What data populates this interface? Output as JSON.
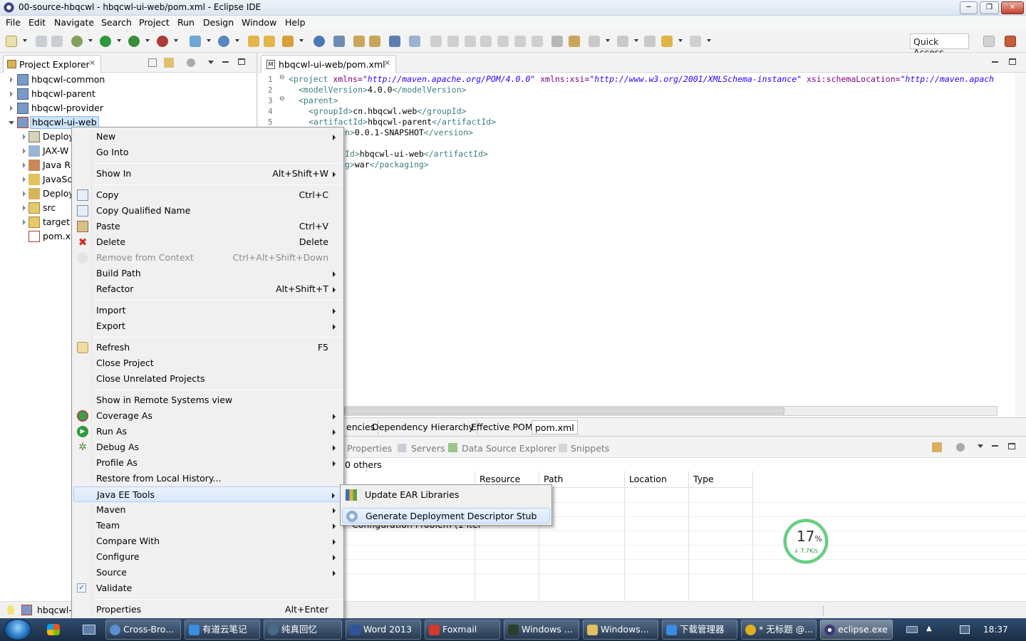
{
  "window": {
    "title": "00-source-hbqcwl - hbqcwl-ui-web/pom.xml - Eclipse IDE",
    "minimize": "─",
    "maximize": "❐",
    "close": "✕"
  },
  "menubar": [
    "File",
    "Edit",
    "Navigate",
    "Search",
    "Project",
    "Run",
    "Design",
    "Window",
    "Help"
  ],
  "toolbar": {
    "quick_access": "Quick Access"
  },
  "explorer": {
    "tab_label": "Project Explorer",
    "items": [
      "hbqcwl-common",
      "hbqcwl-parent",
      "hbqcwl-provider",
      "hbqcwl-ui-web"
    ],
    "children": [
      "Deploy",
      "JAX-W",
      "Java R",
      "JavaSc",
      "Deploy",
      "src",
      "target",
      "pom.xr"
    ]
  },
  "editor": {
    "tab_label": "hbqcwl-ui-web/pom.xml",
    "line_numbers": [
      "1",
      "2",
      "3",
      "4",
      "5"
    ],
    "lines": [
      {
        "tag1": "<project",
        "att1": " xmlns=",
        "val1": "\"http://maven.apache.org/POM/4.0.0\"",
        "att2": " xmlns:xsi=",
        "val2": "\"http://www.w3.org/2001/XMLSchema-instance\"",
        "att3": " xsi:schemaLocation=",
        "val3": "\"http://maven.apach"
      },
      {
        "open": "<modelVersion>",
        "text": "4.0.0",
        "close": "</modelVersion>"
      },
      {
        "open": "<parent>"
      },
      {
        "open": "<groupId>",
        "text": "cn.hbqcwl.web",
        "close": "</groupId>"
      },
      {
        "open": "<artifactId>",
        "text": "hbqcwl-parent",
        "close": "</artifactId>"
      },
      {
        "open": "n>",
        "text": "0.0.1-SNAPSHOT",
        "close": "</version>"
      },
      {
        "open": "Id>",
        "text": "hbqcwl-ui-web",
        "close": "</artifactId>"
      },
      {
        "open": "g>",
        "text": "war",
        "close": "</packaging>"
      }
    ]
  },
  "pom_tabs": [
    "encies",
    "Dependency Hierarchy",
    "Effective POM",
    "pom.xml"
  ],
  "bottom": {
    "tabs": [
      "Properties",
      "Servers",
      "Data Source Explorer",
      "Snippets"
    ],
    "summary": "0 others",
    "columns": [
      "Resource",
      "Path",
      "Location",
      "Type"
    ],
    "row_text": "Configuration Problem (1 iter"
  },
  "context_menu": [
    {
      "label": "New",
      "submenu": true
    },
    {
      "label": "Go Into"
    },
    {
      "sep": true
    },
    {
      "label": "Show In",
      "shortcut": "Alt+Shift+W",
      "submenu": true
    },
    {
      "sep": true
    },
    {
      "label": "Copy",
      "shortcut": "Ctrl+C",
      "icon": "copy-icon"
    },
    {
      "label": "Copy Qualified Name",
      "icon": "copy-qualified-icon"
    },
    {
      "label": "Paste",
      "shortcut": "Ctrl+V",
      "icon": "paste-icon"
    },
    {
      "label": "Delete",
      "shortcut": "Delete",
      "icon": "delete-icon"
    },
    {
      "label": "Remove from Context",
      "shortcut": "Ctrl+Alt+Shift+Down",
      "disabled": true,
      "icon": "remove-context-icon"
    },
    {
      "label": "Build Path",
      "submenu": true
    },
    {
      "label": "Refactor",
      "shortcut": "Alt+Shift+T",
      "submenu": true
    },
    {
      "sep": true
    },
    {
      "label": "Import",
      "submenu": true
    },
    {
      "label": "Export",
      "submenu": true
    },
    {
      "sep": true
    },
    {
      "label": "Refresh",
      "shortcut": "F5",
      "icon": "refresh-icon"
    },
    {
      "label": "Close Project"
    },
    {
      "label": "Close Unrelated Projects"
    },
    {
      "sep": true
    },
    {
      "label": "Show in Remote Systems view"
    },
    {
      "label": "Coverage As",
      "submenu": true,
      "icon": "coverage-icon"
    },
    {
      "label": "Run As",
      "submenu": true,
      "icon": "run-icon"
    },
    {
      "label": "Debug As",
      "submenu": true,
      "icon": "debug-icon"
    },
    {
      "label": "Profile As",
      "submenu": true
    },
    {
      "label": "Restore from Local History..."
    },
    {
      "label": "Java EE Tools",
      "submenu": true,
      "highlight": true
    },
    {
      "label": "Maven",
      "submenu": true
    },
    {
      "label": "Team",
      "submenu": true
    },
    {
      "label": "Compare With",
      "submenu": true
    },
    {
      "label": "Configure",
      "submenu": true
    },
    {
      "label": "Source",
      "submenu": true
    },
    {
      "label": "Validate",
      "icon": "checkbox-icon"
    },
    {
      "sep": true
    },
    {
      "label": "Properties",
      "shortcut": "Alt+Enter"
    }
  ],
  "submenu": [
    {
      "label": "Update EAR Libraries",
      "icon": "ear-libraries-icon"
    },
    {
      "label": "Generate Deployment Descriptor Stub",
      "icon": "descriptor-stub-icon",
      "highlight": true
    }
  ],
  "statusbar": {
    "project": "hbqcwl-"
  },
  "speed_widget": {
    "percent": "17",
    "unit": "%",
    "rate": "↓ 7.7K/s"
  },
  "taskbar": {
    "buttons": [
      "Cross-Bro...",
      "有道云笔记",
      "纯真回忆",
      "Word 2013",
      "Foxmail",
      "Windows ...",
      "Windows...",
      "下载管理器",
      "* 无标题 @...",
      "eclipse.exe"
    ],
    "clock": "18:37"
  }
}
